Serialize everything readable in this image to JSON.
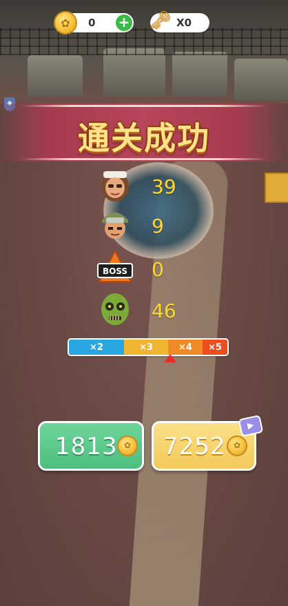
{
  "hud": {
    "coins": "0",
    "keys": "X0"
  },
  "banner": {
    "title": "通关成功"
  },
  "kills": [
    {
      "icon": "woman-survivor-face-icon",
      "count": "39"
    },
    {
      "icon": "soldier-face-icon",
      "count": "9"
    },
    {
      "icon": "boss-warning-icon",
      "label": "BOSS",
      "count": "0"
    },
    {
      "icon": "zombie-face-icon",
      "count": "46"
    }
  ],
  "multiplier": {
    "segments": [
      "×2",
      "×3",
      "×4",
      "×5"
    ],
    "colors": [
      "#2aa6e0",
      "#f2b531",
      "#f08a26",
      "#ee4e1e"
    ]
  },
  "rewards": {
    "normal": "1813",
    "video": "7252"
  },
  "colors": {
    "banner": "#b8455a",
    "count_text": "#ffd832",
    "green_button": "#4cbf7f",
    "gold_button": "#f3c95a"
  }
}
